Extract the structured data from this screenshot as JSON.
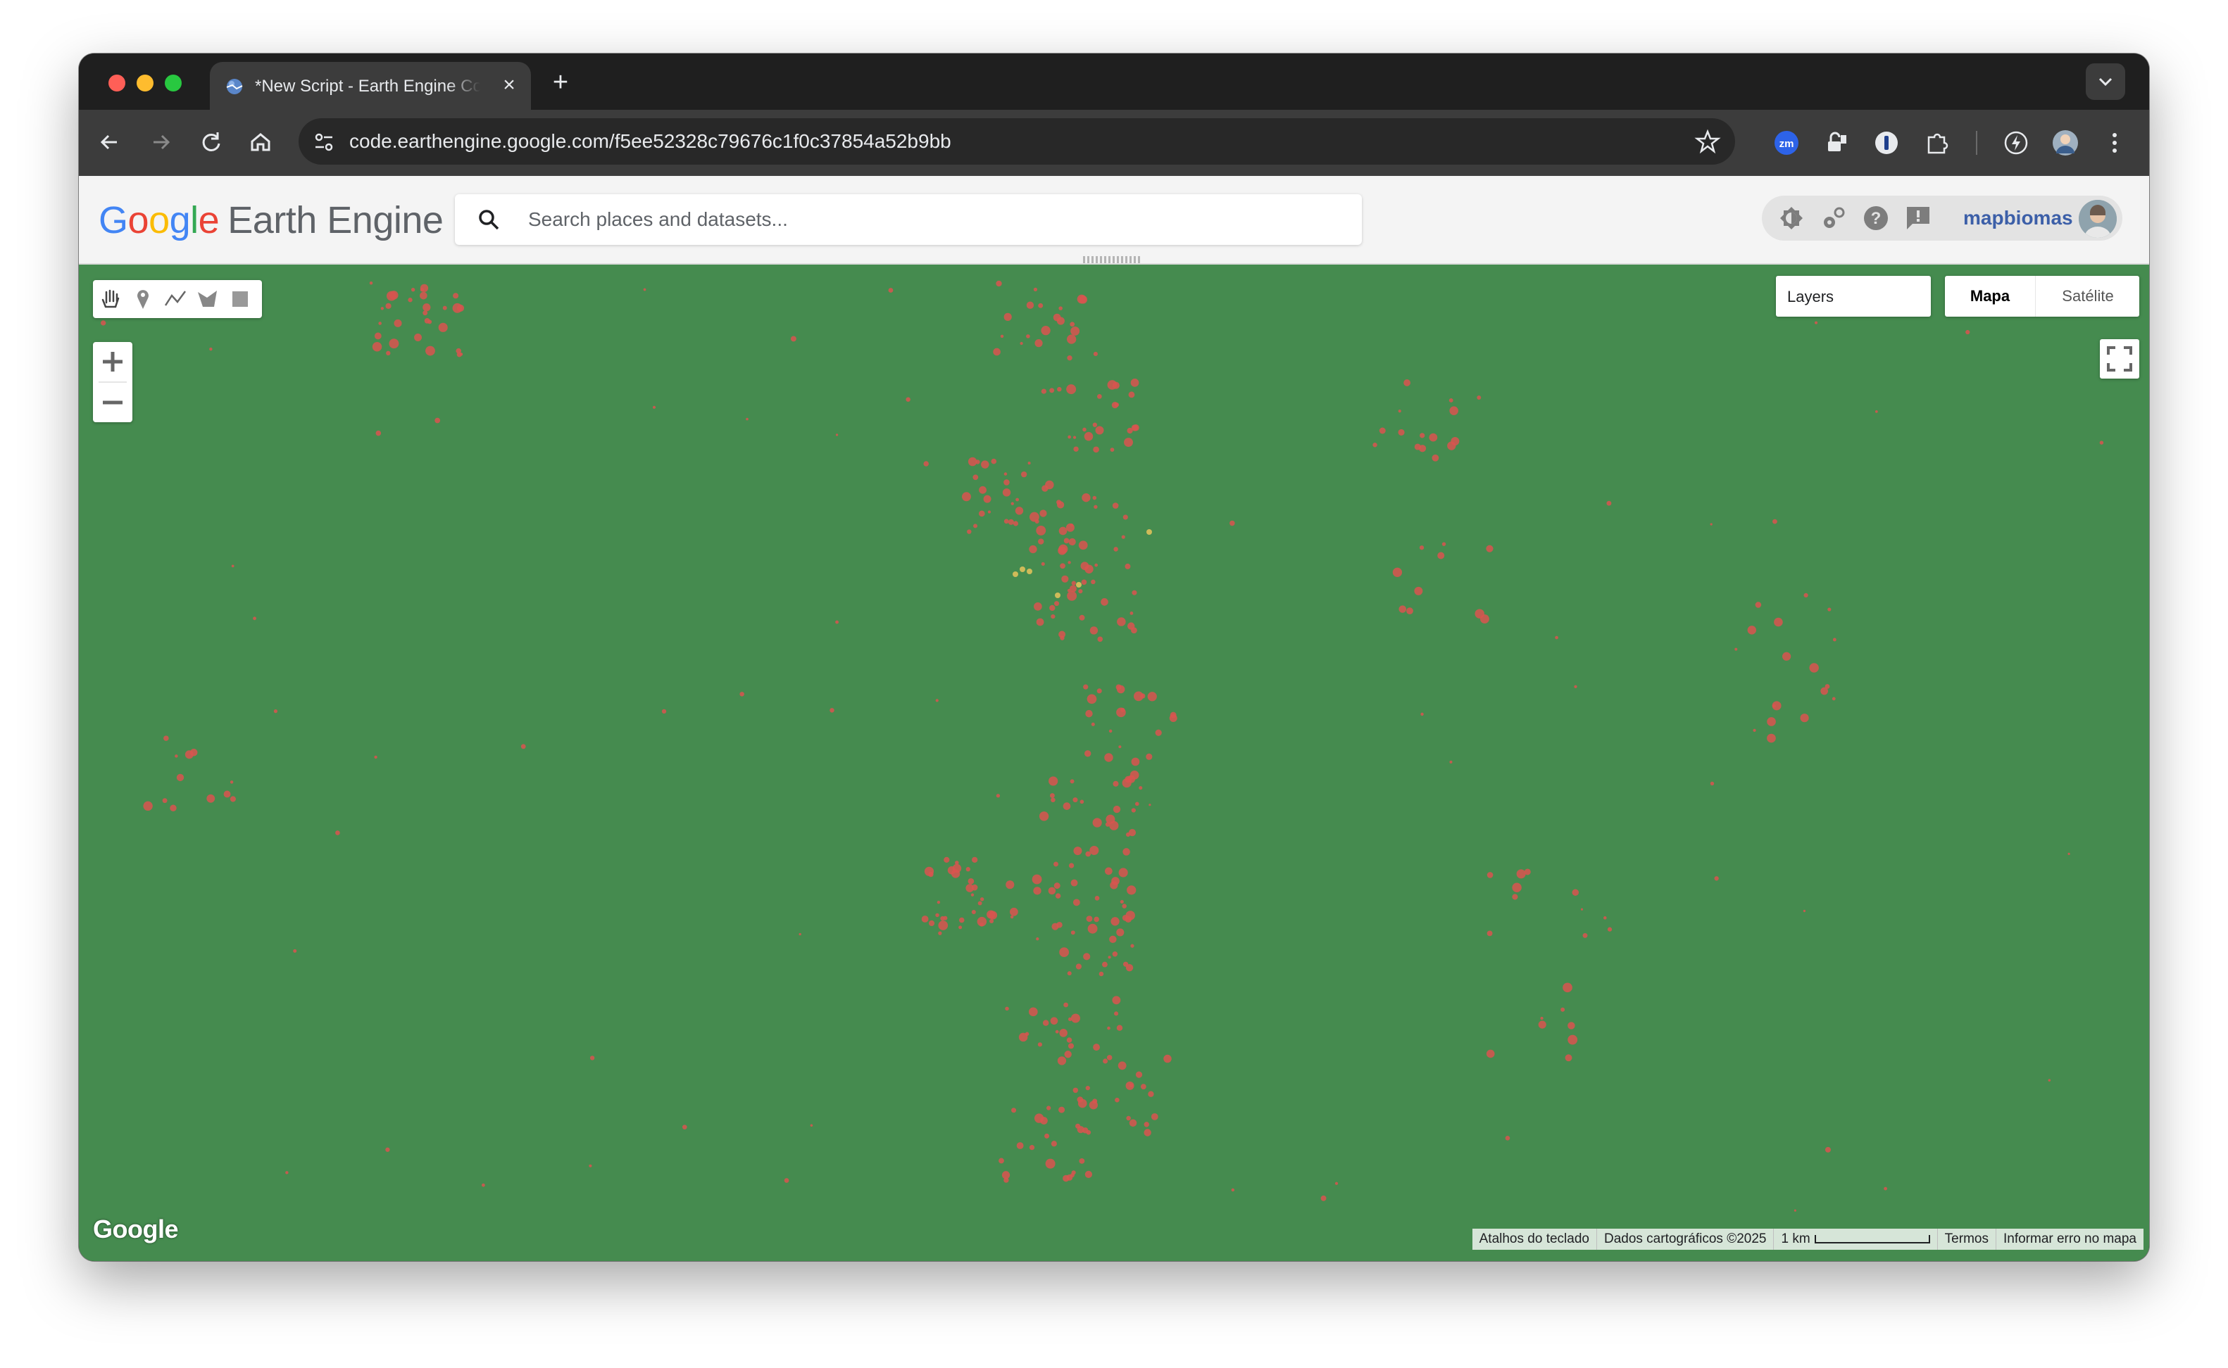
{
  "browser": {
    "tab_title": "*New Script - Earth Engine Code Editor",
    "new_tab_glyph": "+",
    "close_glyph": "×",
    "url": "code.earthengine.google.com/f5ee52328c79676c1f0c37854a52b9bb",
    "extensions": [
      "zoom-extension-icon",
      "lock-extension-icon",
      "password-manager-icon",
      "puzzle-extensions-icon",
      "lightning-icon",
      "profile-avatar",
      "more-menu-icon"
    ]
  },
  "header": {
    "logo_google": "Google",
    "logo_product": "Earth Engine",
    "search_placeholder": "Search places and datasets...",
    "username": "mapbiomas",
    "icons": [
      "theme-icon",
      "settings-icon",
      "help-icon",
      "feedback-icon"
    ]
  },
  "map": {
    "background_color": "#458b4f",
    "patch_color": "#d9534f",
    "highlight_color": "#e8c35a",
    "draw_tools": [
      "hand-icon",
      "marker-icon",
      "line-icon",
      "polygon-icon",
      "rectangle-icon"
    ],
    "zoom_in": "+",
    "zoom_out": "−",
    "layers_label": "Layers",
    "map_type_map": "Mapa",
    "map_type_satellite": "Satélite",
    "watermark": "Google",
    "attribution": {
      "keyboard": "Atalhos do teclado",
      "map_data": "Dados cartográficos ©2025",
      "scale": "1 km",
      "terms": "Termos",
      "report": "Informar erro no mapa"
    }
  }
}
